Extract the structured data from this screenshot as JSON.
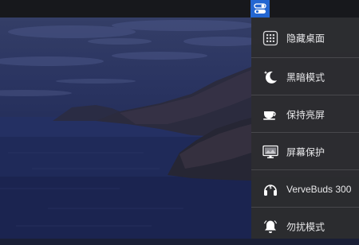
{
  "menubar": {
    "toggle_icon": "toggle-switches-icon",
    "accent": "#2366d1"
  },
  "wallpaper": {
    "description_icon": "coastline-wallpaper"
  },
  "menu": {
    "items": [
      {
        "label": "隐藏桌面",
        "icon": "grid-icon"
      },
      {
        "label": "黑暗模式",
        "icon": "moon-icon"
      },
      {
        "label": "保持亮屏",
        "icon": "coffee-cup-icon"
      },
      {
        "label": "屏幕保护",
        "icon": "monitor-icon"
      },
      {
        "label": "VerveBuds 300",
        "icon": "headphones-icon"
      },
      {
        "label": "勿扰模式",
        "icon": "bell-icon"
      }
    ]
  }
}
